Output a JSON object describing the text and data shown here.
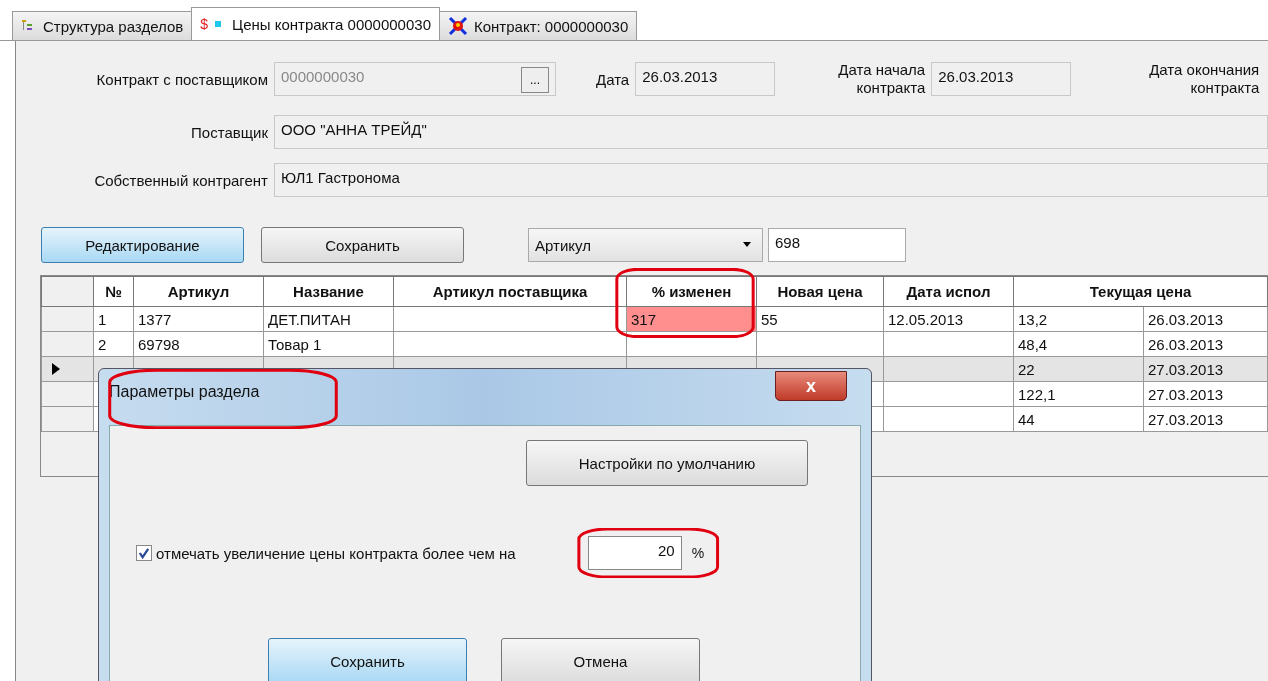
{
  "tabs": [
    {
      "label": "Структура разделов",
      "kind": "tree",
      "selected": false
    },
    {
      "label": "Цены контракта 0000000030",
      "kind": "price",
      "glyph": "$",
      "selected": true
    },
    {
      "label": "Контракт: 0000000030",
      "kind": "contract",
      "selected": false
    }
  ],
  "form": {
    "contract_label": "Контракт с поставщиком",
    "contract_value": "0000000030",
    "browse_button": "...",
    "date_label": "Дата",
    "date_value": "26.03.2013",
    "start_label": "Дата начала контракта",
    "start_value": "26.03.2013",
    "end_label": "Дата окончания контракта",
    "supplier_label": "Поставщик",
    "supplier_value": "ООО \"АННА ТРЕЙД\"",
    "own_label": "Собственный контрагент",
    "own_value": "ЮЛ1 Гастронома"
  },
  "toolbar": {
    "edit_button": "Редактирование",
    "save_button": "Сохранить",
    "field_select": "Артикул",
    "search_value": "698"
  },
  "table": {
    "columns": [
      {
        "label": "№",
        "circled": false
      },
      {
        "label": "Артикул",
        "circled": false
      },
      {
        "label": "Название",
        "circled": false
      },
      {
        "label": "Артикул поставщика",
        "circled": false
      },
      {
        "label": "% изменен",
        "circled": true
      },
      {
        "label": "Новая цена",
        "circled": false
      },
      {
        "label": "Дата испол",
        "circled": false
      },
      {
        "label": "Текущая цена",
        "colspan": 2,
        "circled": false
      }
    ],
    "rows": [
      {
        "selected": false,
        "flagged": true,
        "cells": [
          "1",
          "1377",
          "ДЕТ.ПИТАН",
          null,
          "317",
          "55",
          "12.05.2013",
          "13,2",
          "26.03.2013"
        ]
      },
      {
        "selected": false,
        "flagged": false,
        "cells": [
          "2",
          "69798",
          "Товар 1",
          null,
          null,
          null,
          null,
          "48,4",
          "26.03.2013"
        ]
      },
      {
        "selected": true,
        "cells": [
          null,
          null,
          null,
          null,
          null,
          null,
          null,
          "22",
          "27.03.2013"
        ]
      },
      {
        "selected": false,
        "cells": [
          null,
          null,
          null,
          null,
          null,
          null,
          null,
          "122,1",
          "27.03.2013"
        ]
      },
      {
        "selected": false,
        "cells": [
          null,
          null,
          null,
          null,
          null,
          null,
          null,
          "44",
          "27.03.2013"
        ]
      }
    ]
  },
  "dialog": {
    "title": "Параметры раздела",
    "title_circled": true,
    "close_glyph": "x",
    "defaults_button": "Настройки по умолчанию",
    "checkbox_label": "отмечать увеличение цены контракта более чем на",
    "checked": true,
    "percent_value": "20",
    "percent_circled": true,
    "percent_unit": "%",
    "save_button": "Сохранить",
    "cancel_button": "Отмена"
  }
}
